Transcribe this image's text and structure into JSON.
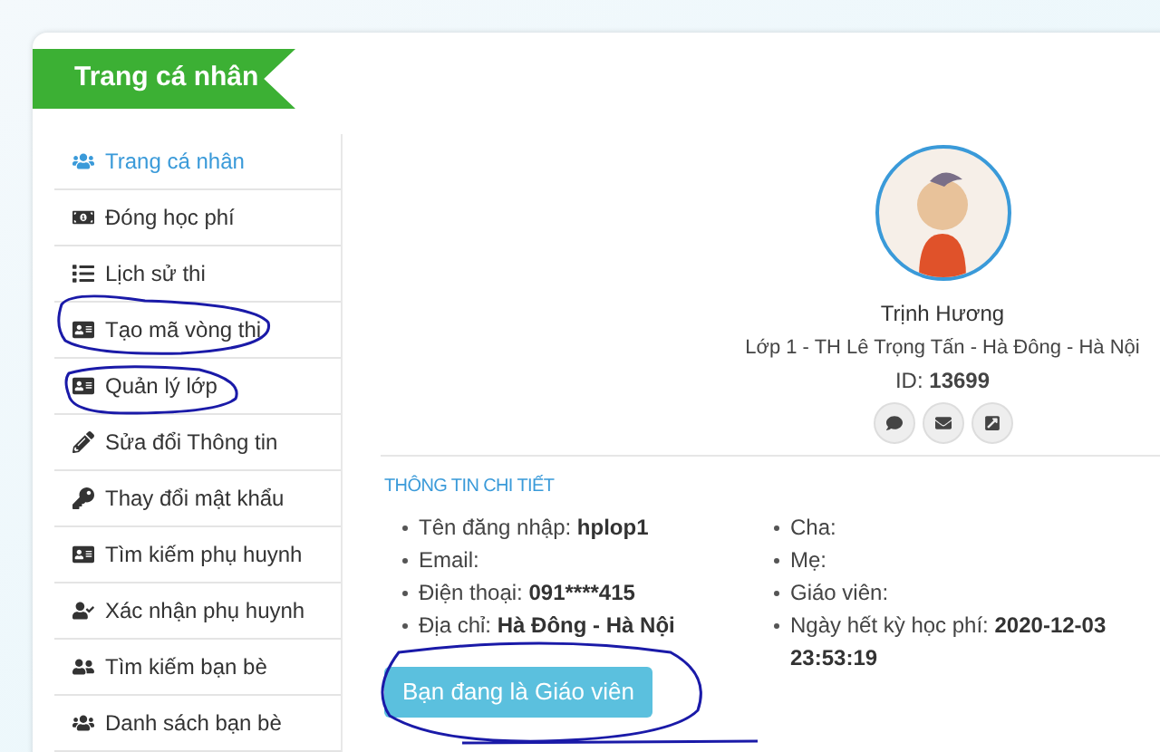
{
  "header": {
    "title": "Trang cá nhân"
  },
  "sidebar": {
    "items": [
      {
        "label": "Trang cá nhân",
        "kind": "users",
        "selected": true
      },
      {
        "label": "Đóng học phí",
        "kind": "money",
        "selected": false
      },
      {
        "label": "Lịch sử thi",
        "kind": "list",
        "selected": false
      },
      {
        "label": "Tạo mã vòng thi",
        "kind": "card",
        "selected": false
      },
      {
        "label": "Quản lý lớp",
        "kind": "card",
        "selected": false
      },
      {
        "label": "Sửa đổi Thông tin",
        "kind": "pencil",
        "selected": false
      },
      {
        "label": "Thay đổi mật khẩu",
        "kind": "key",
        "selected": false
      },
      {
        "label": "Tìm kiếm phụ huynh",
        "kind": "card",
        "selected": false
      },
      {
        "label": "Xác nhận phụ huynh",
        "kind": "usercheck",
        "selected": false
      },
      {
        "label": "Tìm kiếm bạn bè",
        "kind": "usersearch",
        "selected": false
      },
      {
        "label": "Danh sách bạn bè",
        "kind": "users",
        "selected": false
      }
    ]
  },
  "profile": {
    "name": "Trịnh Hương",
    "school": "Lớp 1 - TH Lê Trọng Tấn - Hà Đông - Hà Nội",
    "id_label": "ID:",
    "id_value": "13699"
  },
  "details": {
    "title": "THÔNG TIN CHI TIẾT",
    "left": [
      {
        "label": "Tên đăng nhập:",
        "value": "hplop1"
      },
      {
        "label": "Email:"
      },
      {
        "label": "Điện thoại:",
        "value": "091****415"
      },
      {
        "label": "Địa chỉ:",
        "value": "Hà Đông - Hà Nội"
      }
    ],
    "right": [
      {
        "label": "Cha:"
      },
      {
        "label": "Mẹ:"
      },
      {
        "label": "Giáo viên:"
      },
      {
        "label": "Ngày hết kỳ học phí:",
        "value": "2020-12-03 23:53:19"
      }
    ]
  },
  "role_button": "Bạn đang là Giáo viên"
}
